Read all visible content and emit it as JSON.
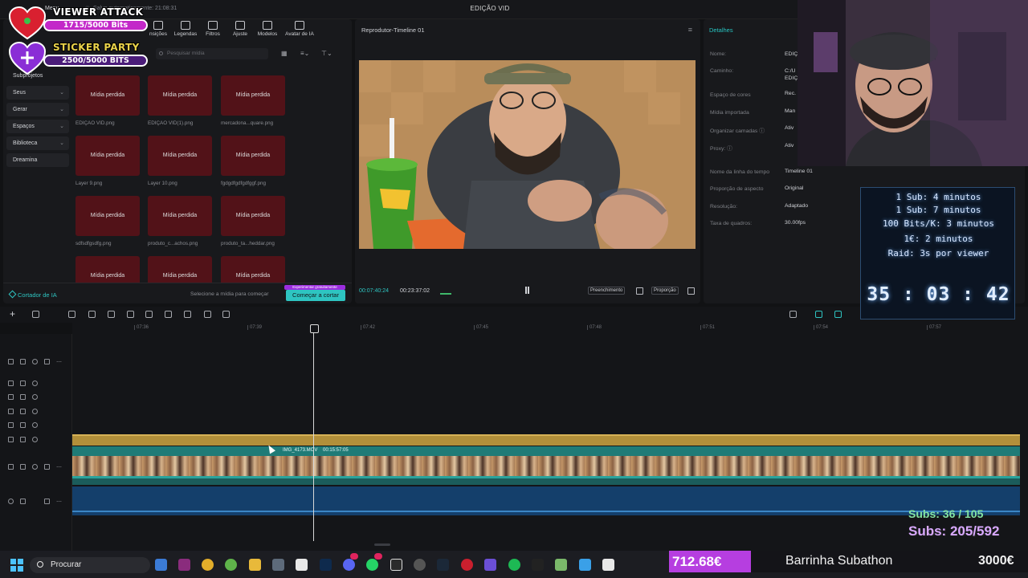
{
  "titlebar": {
    "title": "EDIÇÃO VID",
    "menu": "Menu",
    "autosave": "Salvo automaticamente: 21:08:31"
  },
  "media_panel": {
    "tabs": [
      "nsições",
      "Legendas",
      "Filtros",
      "Ajuste",
      "Modelos",
      "Avatar de IA"
    ],
    "side_nav": [
      "Subprojetos",
      "Seus",
      "Gerar",
      "Espaços",
      "Biblioteca",
      "Dreamina"
    ],
    "search_placeholder": "Pesquisar mídia",
    "items": [
      {
        "label": "Mídia perdida",
        "name": "EDIÇÃO VID.png"
      },
      {
        "label": "Mídia perdida",
        "name": "EDIÇÃO VID(1).png"
      },
      {
        "label": "Mídia perdida",
        "name": "mercadona...quare.png"
      },
      {
        "label": "Mídia perdida",
        "name": "Layer 9.png"
      },
      {
        "label": "Mídia perdida",
        "name": "Layer 10.png"
      },
      {
        "label": "Mídia perdida",
        "name": "fgdgdfgdfgdfggf.png"
      },
      {
        "label": "Mídia perdida",
        "name": "sdfsdfgsdfg.png"
      },
      {
        "label": "Mídia perdida",
        "name": "produto_c...achos.png"
      },
      {
        "label": "Mídia perdida",
        "name": "produto_ta...heddar.png"
      },
      {
        "label": "Mídia perdida",
        "name": ""
      },
      {
        "label": "Mídia perdida",
        "name": ""
      },
      {
        "label": "Mídia perdida",
        "name": ""
      }
    ],
    "ai_cutter": "Cortador de IA",
    "ai_hint": "Selecione a mídia para começar",
    "start_button": "Começar a cortar",
    "free_badge": "Experimentar gratuitamente"
  },
  "player": {
    "title": "Reprodutor-Timeline 01",
    "current_time": "00:07:40:24",
    "total_time": "00:23:37:02",
    "fill_button": "Preenchimento",
    "ratio_button": "Proporção"
  },
  "details": {
    "title": "Detalhes",
    "rows": [
      {
        "label": "Nome:",
        "value": "EDIÇ"
      },
      {
        "label": "Caminho:",
        "value": "C:/U"
      },
      {
        "label": "",
        "value": "EDIÇ"
      },
      {
        "label": "Espaço de cores",
        "value": "Rec."
      },
      {
        "label": "Mídia importada",
        "value": "Man"
      },
      {
        "label": "Organizar camadas ⓘ",
        "value": "Ativ"
      },
      {
        "label": "Proxy: ⓘ",
        "value": "Ativ"
      },
      {
        "label": "Nome da linha do tempo",
        "value": "Timeline 01"
      },
      {
        "label": "Proporção de aspecto",
        "value": "Original"
      },
      {
        "label": "Resolução:",
        "value": "Adaptado"
      },
      {
        "label": "Taxa de quadros:",
        "value": "30.00fps"
      }
    ]
  },
  "timeline": {
    "ticks": [
      "07:36",
      "07:39",
      "07:42",
      "07:45",
      "07:48",
      "07:51",
      "07:54",
      "07:57"
    ],
    "clip_name": "IMG_4173.MOV",
    "clip_length": "00:15:57:05"
  },
  "overlay": {
    "goal1": {
      "title": "VIEWER ATTACK",
      "progress": "1715/5000 Bits",
      "fraction": 0.343
    },
    "goal2": {
      "title": "STICKER PARTY",
      "progress": "2500/5000 BITS",
      "fraction": 0.5
    },
    "rules": [
      "1 Sub: 4 minutos",
      "1 Sub: 7 minutos",
      "100 Bits/K: 3 minutos",
      "1€: 2 minutos",
      "Raid: 3s por viewer"
    ],
    "countdown": "35 : 03 : 42",
    "subs_line1": "Subs: 36 / 105",
    "subs_line2": "Subs: 205/592",
    "money": "712.68€",
    "money_label": "Barrinha Subathon",
    "money_goal": "3000€"
  },
  "taskbar": {
    "search": "Procurar"
  },
  "colors": {
    "accent": "#2ec4c1",
    "missing_media": "#521218",
    "audio": "#143f6b",
    "video_clip": "#1f7b77"
  }
}
